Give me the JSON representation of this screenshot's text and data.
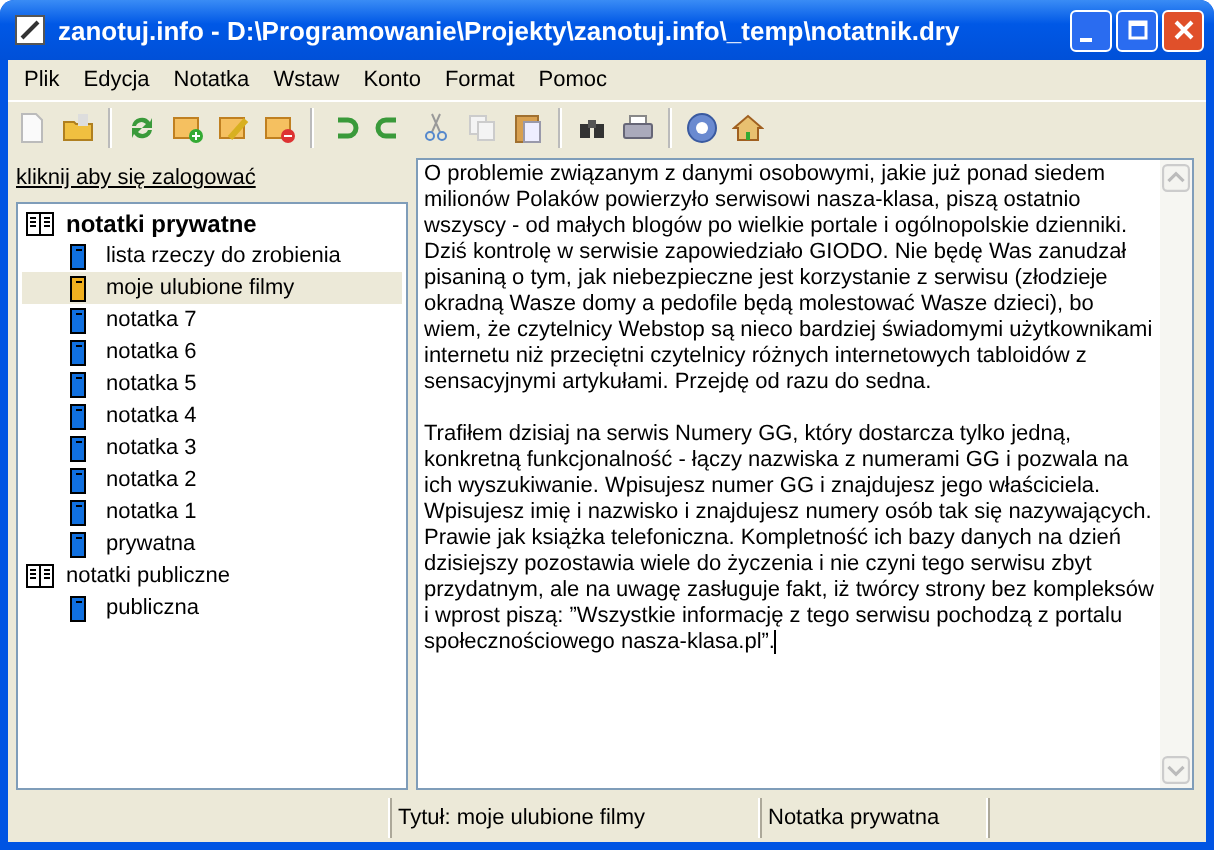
{
  "window": {
    "title": "zanotuj.info - D:\\Programowanie\\Projekty\\zanotuj.info\\_temp\\notatnik.dry"
  },
  "menu": [
    "Plik",
    "Edycja",
    "Notatka",
    "Wstaw",
    "Konto",
    "Format",
    "Pomoc"
  ],
  "login_link": "kliknij aby się zalogować",
  "tree": [
    {
      "label": "notatki prywatne",
      "kind": "group",
      "active": true,
      "children": [
        {
          "label": "lista rzeczy do zrobienia",
          "kind": "note",
          "selected": false
        },
        {
          "label": "moje ulubione filmy",
          "kind": "note",
          "selected": true
        },
        {
          "label": "notatka 7",
          "kind": "note",
          "selected": false
        },
        {
          "label": "notatka 6",
          "kind": "note",
          "selected": false
        },
        {
          "label": "notatka 5",
          "kind": "note",
          "selected": false
        },
        {
          "label": "notatka 4",
          "kind": "note",
          "selected": false
        },
        {
          "label": "notatka 3",
          "kind": "note",
          "selected": false
        },
        {
          "label": "notatka 2",
          "kind": "note",
          "selected": false
        },
        {
          "label": "notatka 1",
          "kind": "note",
          "selected": false
        },
        {
          "label": "prywatna",
          "kind": "note",
          "selected": false
        }
      ]
    },
    {
      "label": "notatki publiczne",
      "kind": "group",
      "active": false,
      "children": [
        {
          "label": "publiczna",
          "kind": "note",
          "selected": false
        }
      ]
    }
  ],
  "editor": {
    "paragraphs": [
      "O problemie związanym z danymi osobowymi, jakie już ponad siedem milionów Polaków powierzyło serwisowi nasza-klasa, piszą ostatnio wszyscy - od małych blogów po wielkie portale i ogólnopolskie dzienniki. Dziś kontrolę w serwisie zapowiedziało GIODO. Nie będę Was zanudzał pisaniną o tym, jak niebezpieczne jest korzystanie z serwisu (złodzieje okradną Wasze domy a pedofile będą molestować Wasze dzieci), bo wiem, że czytelnicy Webstop są nieco bardziej świadomymi użytkownikami internetu niż przeciętni czytelnicy różnych internetowych tabloidów z sensacyjnymi artykułami. Przejdę od razu do sedna.",
      "Trafiłem dzisiaj na serwis Numery GG, który dostarcza tylko jedną, konkretną funkcjonalność - łączy nazwiska z numerami GG i pozwala na ich wyszukiwanie. Wpisujesz numer GG i znajdujesz jego właściciela. Wpisujesz imię i nazwisko i znajdujesz numery osób tak się nazywających. Prawie jak książka telefoniczna. Kompletność ich bazy danych na dzień dzisiejszy pozostawia wiele do życzenia i nie czyni tego serwisu zbyt przydatnym, ale na uwagę zasługuje fakt, iż twórcy strony bez kompleksów i wprost piszą: ”Wszystkie informację z tego serwisu pochodzą z portalu społecznościowego nasza-klasa.pl”."
    ]
  },
  "status_bar": [
    "Tytuł: moje ulubione filmy",
    "Notatka prywatna"
  ]
}
